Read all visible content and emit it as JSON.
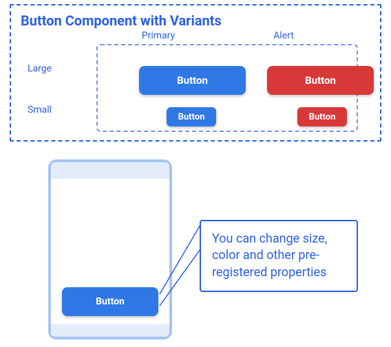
{
  "title": "Button Component with Variants",
  "columns": {
    "primary": "Primary",
    "alert": "Alert"
  },
  "rows": {
    "large": "Large",
    "small": "Small"
  },
  "button_label": "Button",
  "phone_button_label": "Button",
  "callout_text": "You can change size, color and other pre-registered properties"
}
